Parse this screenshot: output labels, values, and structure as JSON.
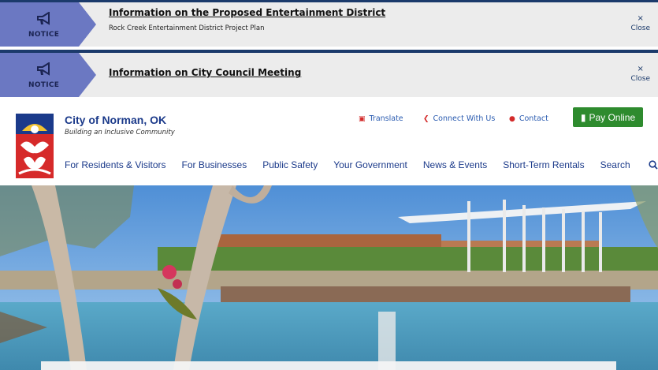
{
  "notices": [
    {
      "tag": "NOTICE",
      "title": "Information on the Proposed Entertainment District",
      "subtitle": "Rock Creek Entertainment District Project Plan",
      "close_symbol": "×",
      "close_label": "Close"
    },
    {
      "tag": "NOTICE",
      "title": "Information on City Council Meeting",
      "close_symbol": "×",
      "close_label": "Close"
    }
  ],
  "site": {
    "name": "City of Norman, OK",
    "tagline": "Building an Inclusive Community"
  },
  "utility": {
    "translate": "Translate",
    "connect": "Connect With Us",
    "contact": "Contact",
    "pay": "Pay Online"
  },
  "nav": [
    "For Residents & Visitors",
    "For Businesses",
    "Public Safety",
    "Your Government",
    "News & Events",
    "Short-Term Rentals"
  ],
  "search_label": "Search",
  "colors": {
    "brand_blue": "#1b3a8a",
    "notice_tag": "#6b78c2",
    "pay_green": "#2e8b2e"
  }
}
